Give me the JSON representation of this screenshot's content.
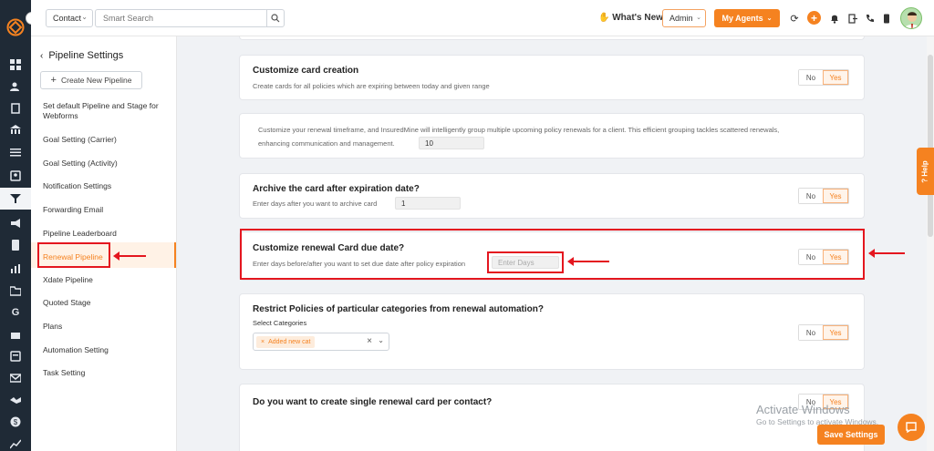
{
  "topbar": {
    "contact_select": "Contact",
    "search_placeholder": "Smart Search",
    "whats_new": "What's New",
    "admin_select": "Admin",
    "my_agents": "My Agents"
  },
  "sidebar": {
    "title": "Pipeline Settings",
    "create_button": "Create New Pipeline",
    "items": [
      {
        "label": "Set default Pipeline and Stage for Webforms"
      },
      {
        "label": "Goal Setting (Carrier)"
      },
      {
        "label": "Goal Setting (Activity)"
      },
      {
        "label": "Notification Settings"
      },
      {
        "label": "Forwarding Email"
      },
      {
        "label": "Pipeline Leaderboard"
      },
      {
        "label": "Renewal Pipeline"
      },
      {
        "label": "Xdate Pipeline"
      },
      {
        "label": "Quoted Stage"
      },
      {
        "label": "Plans"
      },
      {
        "label": "Automation Setting"
      },
      {
        "label": "Task Setting"
      }
    ],
    "active_item": "Renewal Pipeline"
  },
  "settings": {
    "customize_card_creation": {
      "title": "Customize card creation",
      "description": "Create cards for all policies which are expiring between today and given range",
      "no": "No",
      "yes": "Yes"
    },
    "grouping": {
      "description_line1": "Customize your renewal timeframe, and InsuredMine will intelligently group multiple upcoming policy renewals for a client. This efficient grouping tackles scattered renewals,",
      "description_line2": "enhancing communication and management.",
      "value": "10"
    },
    "archive": {
      "title": "Archive the card after expiration date?",
      "description": "Enter days after you want to archive card",
      "value": "1",
      "no": "No",
      "yes": "Yes"
    },
    "due_date": {
      "title": "Customize renewal Card due date?",
      "description": "Enter days before/after you want to set due date after policy expiration",
      "placeholder": "Enter Days",
      "no": "No",
      "yes": "Yes"
    },
    "restrict": {
      "title": "Restrict Policies of particular categories from renewal automation?",
      "select_label": "Select Categories",
      "tag": "Added new cat",
      "no": "No",
      "yes": "Yes"
    },
    "single_card": {
      "title": "Do you want to create single renewal card per contact?",
      "no": "No",
      "yes": "Yes"
    }
  },
  "help_tab": "Help",
  "save_button": "Save Settings",
  "watermark": {
    "line1": "Activate Windows",
    "line2": "Go to Settings to activate Windows."
  },
  "colors": {
    "accent": "#f58220",
    "rail": "#1f2a36",
    "highlight": "#e4161f"
  }
}
